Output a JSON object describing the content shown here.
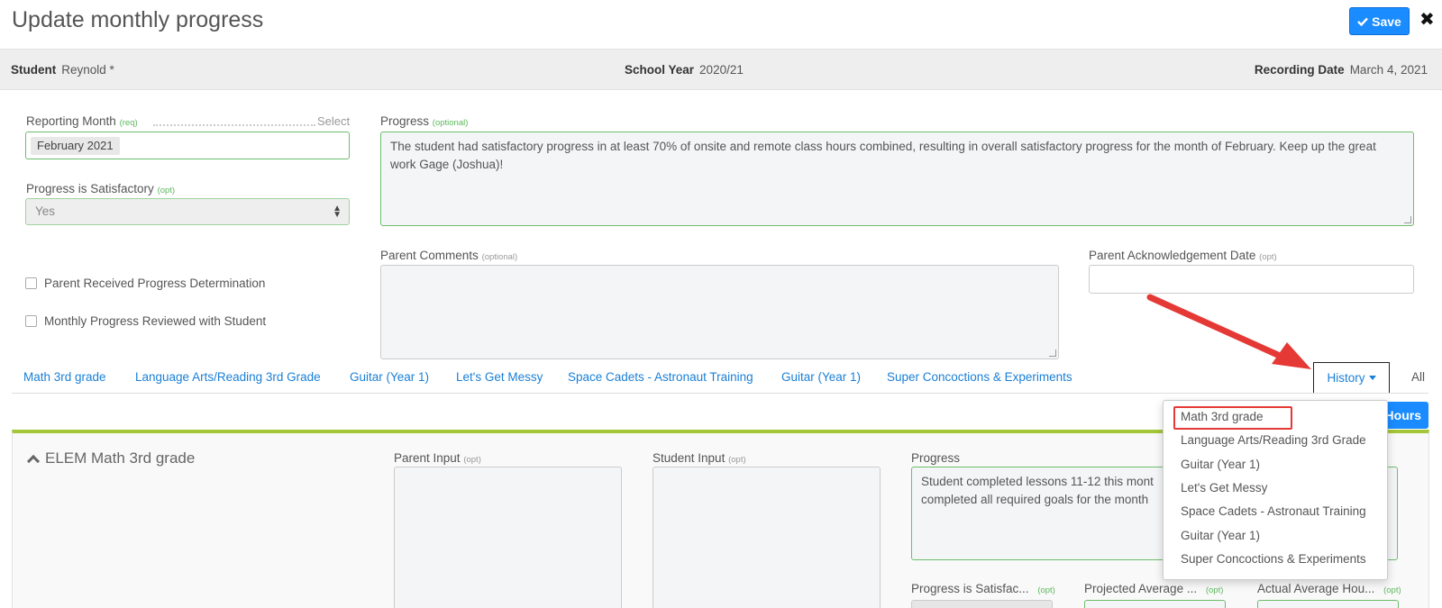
{
  "header": {
    "title": "Update monthly progress",
    "save_label": "Save",
    "close_label": "✖"
  },
  "infobar": {
    "student_label": "Student",
    "student_value": "Reynold *",
    "school_year_label": "School Year",
    "school_year_value": "2020/21",
    "recording_date_label": "Recording Date",
    "recording_date_value": "March 4, 2021"
  },
  "form": {
    "reporting_month_label": "Reporting Month",
    "reporting_month_req": "(req)",
    "select_link": "Select",
    "reporting_month_value": "February 2021",
    "progress_satisfactory_label": "Progress is Satisfactory",
    "progress_satisfactory_opt": "(opt)",
    "progress_satisfactory_value": "Yes",
    "progress_label": "Progress",
    "progress_opt": "(optional)",
    "progress_text": "The student had satisfactory progress in at least 70% of onsite and remote class hours combined, resulting in overall satisfactory progress for the month of February. Keep up the great work Gage (Joshua)!",
    "parent_comments_label": "Parent Comments",
    "parent_comments_opt": "(optional)",
    "parent_ack_label": "Parent Acknowledgement Date",
    "parent_ack_opt": "(opt)",
    "checkbox_parent_received": "Parent Received Progress Determination",
    "checkbox_reviewed": "Monthly Progress Reviewed with Student"
  },
  "tabs": [
    {
      "label": "Math 3rd grade"
    },
    {
      "label": "Language Arts/Reading 3rd Grade"
    },
    {
      "label": "Guitar (Year 1)"
    },
    {
      "label": "Let's Get Messy"
    },
    {
      "label": "Space Cadets - Astronaut Training"
    },
    {
      "label": "Guitar (Year 1)"
    },
    {
      "label": "Super Concoctions & Experiments"
    }
  ],
  "history_label": "History",
  "all_label": "All",
  "hours_label": "Hours",
  "course": {
    "title": "ELEM Math 3rd grade",
    "parent_input_label": "Parent Input",
    "parent_input_opt": "(opt)",
    "student_input_label": "Student Input",
    "student_input_opt": "(opt)",
    "progress_label": "Progress",
    "progress_text_line1": "Student completed lessons 11-12 this mont",
    "progress_text_line2": "completed all required goals for the month",
    "progress_satisfac_label": "Progress is Satisfac...",
    "progress_satisfac_opt": "(opt)",
    "projected_avg_label": "Projected Average ...",
    "projected_avg_opt": "(opt)",
    "actual_avg_label": "Actual Average Hou...",
    "actual_avg_opt": "(opt)"
  },
  "history_dropdown": [
    "Math 3rd grade",
    "Language Arts/Reading 3rd Grade",
    "Guitar (Year 1)",
    "Let's Get Messy",
    "Space Cadets - Astronaut Training",
    "Guitar (Year 1)",
    "Super Concoctions & Experiments"
  ],
  "colors": {
    "primary": "#1a8cff",
    "link": "#1a7fd6",
    "required_green": "#5cb85c",
    "panel_accent": "#a4c639",
    "annotation_red": "#e53935"
  }
}
